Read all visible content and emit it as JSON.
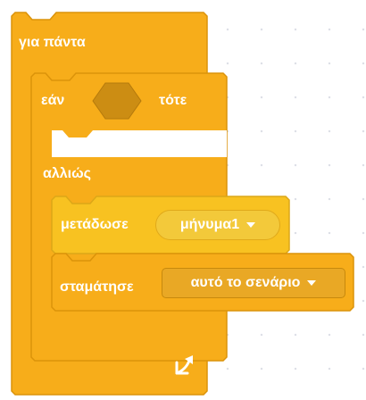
{
  "blocks": {
    "forever": {
      "label": "για πάντα"
    },
    "if_else": {
      "if_label": "εάν",
      "then_label": "τότε",
      "else_label": "αλλιώς"
    },
    "broadcast": {
      "label": "μετάδωσε",
      "message": "μήνυμα1"
    },
    "stop": {
      "label": "σταμάτησε",
      "option": "αυτό το σενάριο"
    }
  },
  "colors": {
    "control_block": "#f7ad1a",
    "control_border": "#db930a",
    "events_block": "#f8c221",
    "events_border": "#dca718",
    "condition_slot": "#cc8d13",
    "canvas_background": "#ffffff"
  }
}
